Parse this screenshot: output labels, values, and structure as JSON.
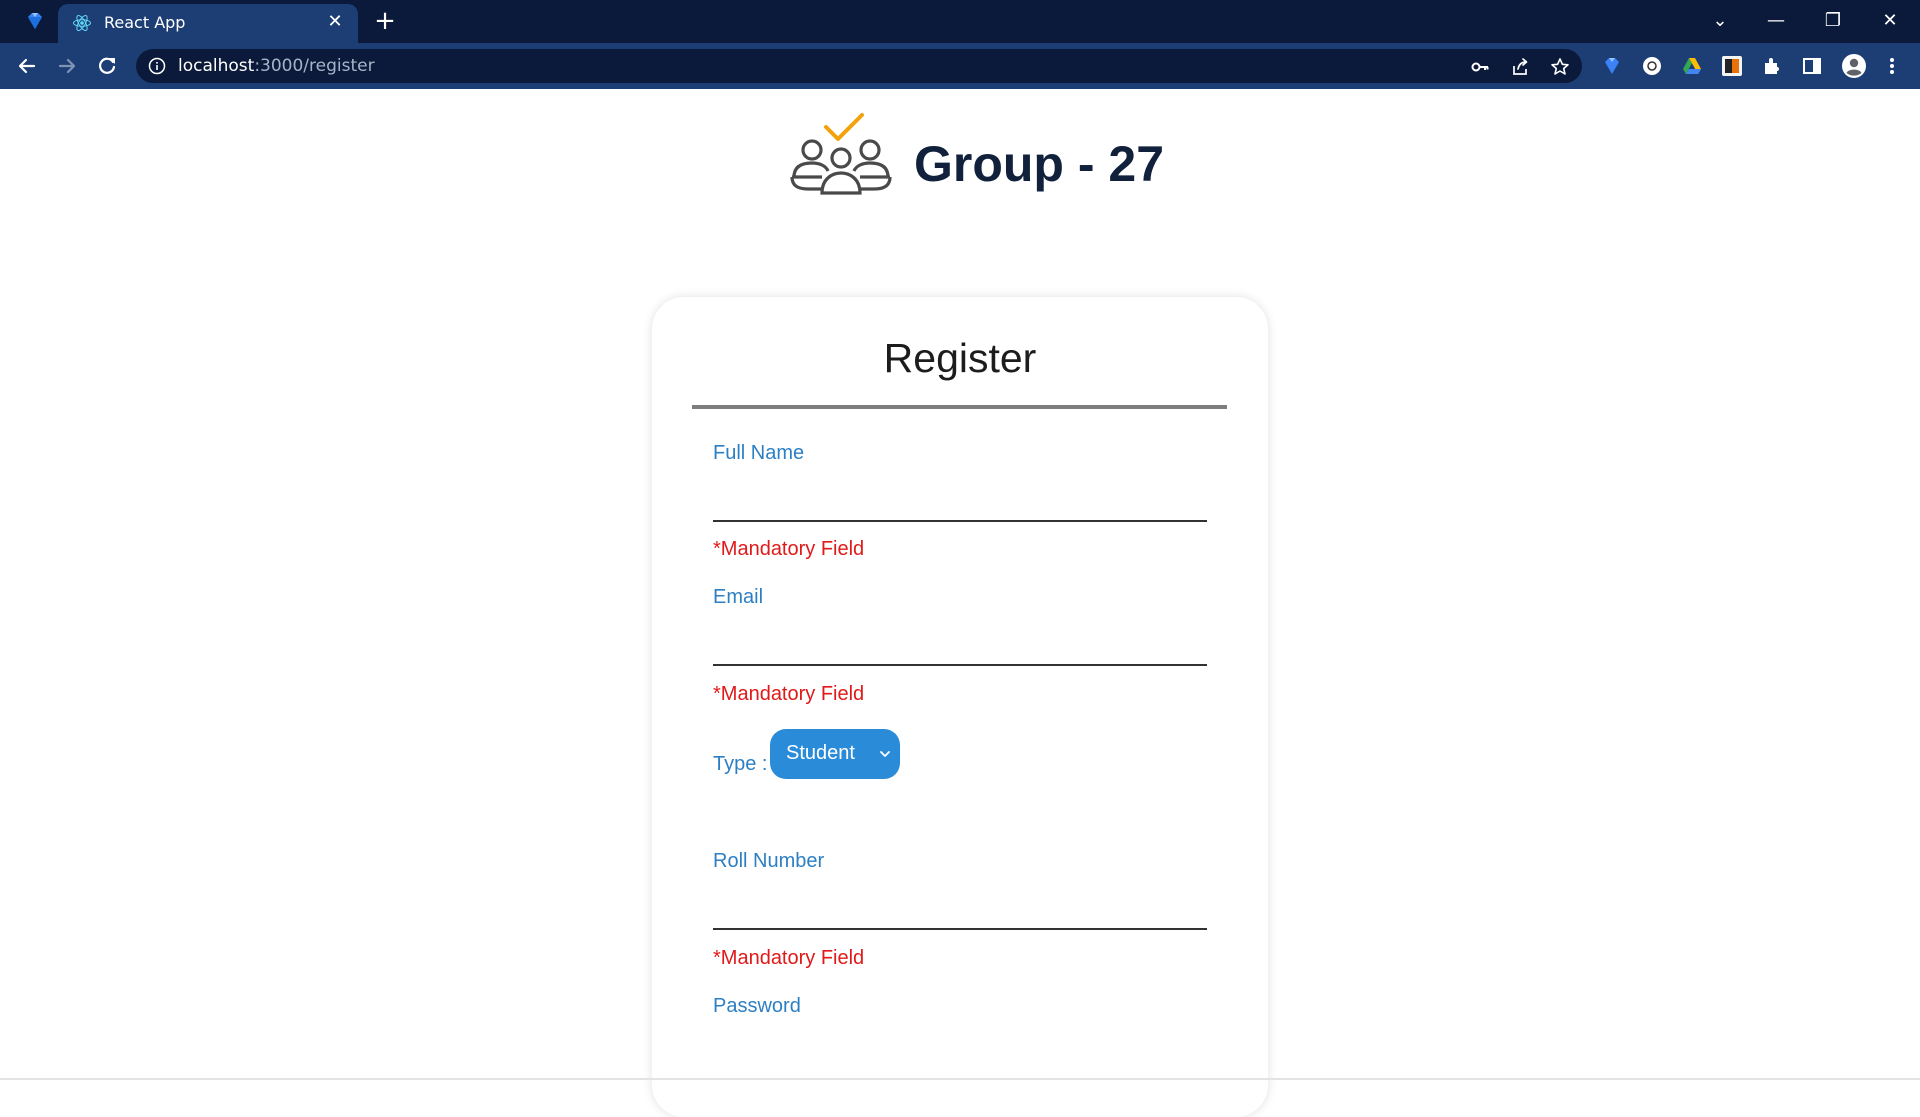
{
  "browser": {
    "tab_title": "React App",
    "tab_close": "✕",
    "new_tab": "+",
    "address": {
      "host": "localhost",
      "rest": ":3000/register"
    },
    "window_controls": {
      "dropdown": "⌄",
      "minimize": "—",
      "restore": "❐",
      "close": "✕"
    }
  },
  "header": {
    "title": "Group - 27"
  },
  "form": {
    "title": "Register",
    "full_name": {
      "label": "Full Name",
      "value": "",
      "error": "*Mandatory Field"
    },
    "email": {
      "label": "Email",
      "value": "",
      "error": "*Mandatory Field"
    },
    "type": {
      "label": "Type :",
      "selected": "Student"
    },
    "roll_number": {
      "label": "Roll Number",
      "value": "",
      "error": "*Mandatory Field"
    },
    "password": {
      "label": "Password"
    }
  },
  "colors": {
    "tabstrip": "#0b1a3a",
    "toolbar": "#1d3e74",
    "label": "#2d7fc4",
    "error": "#e01919",
    "select": "#2a8cd8",
    "logo_check": "#f2a20a"
  }
}
